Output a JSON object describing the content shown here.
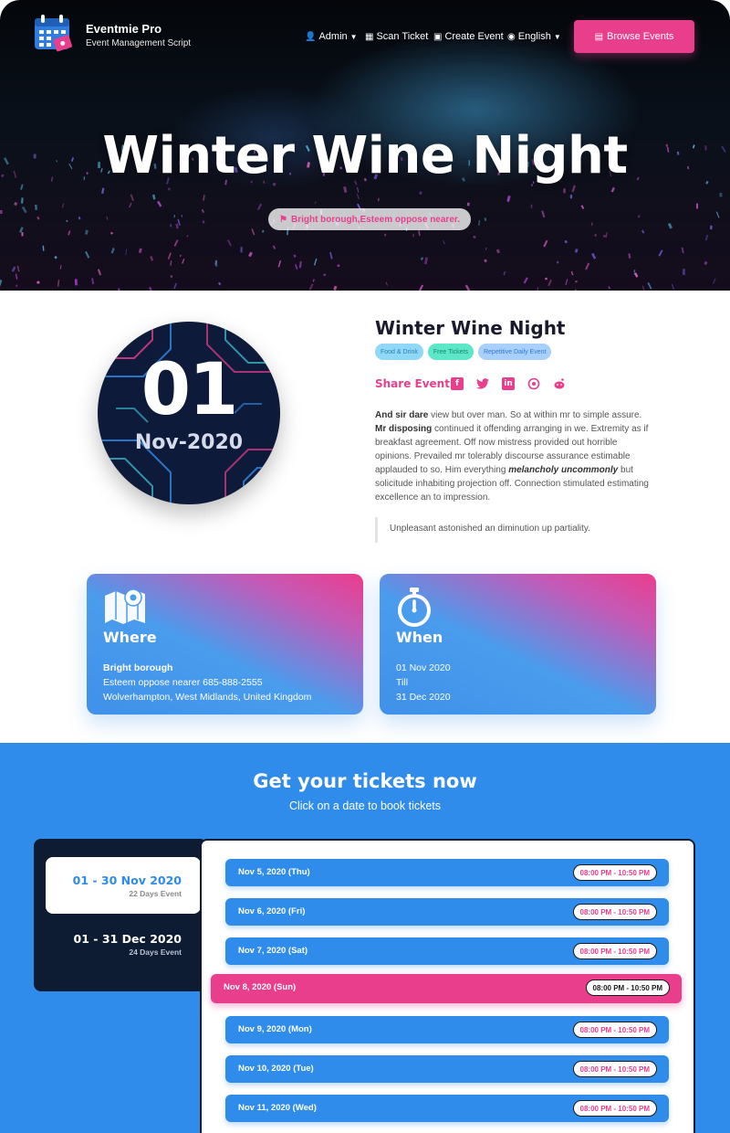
{
  "header": {
    "brand_name": "Eventmie Pro",
    "brand_subtitle": "Event Management Script",
    "nav": [
      {
        "label": "Admin",
        "icon": "user-gear-icon",
        "has_caret": true
      },
      {
        "label": "Scan Ticket",
        "icon": "qr-code-icon",
        "has_caret": false
      },
      {
        "label": "Create Event",
        "icon": "calendar-plus-icon",
        "has_caret": false
      },
      {
        "label": "English",
        "icon": "globe-icon",
        "has_caret": true
      }
    ],
    "browse_label": "Browse Events",
    "accent_color": "#e83e8c"
  },
  "hero": {
    "title": "Winter Wine Night",
    "venue_pill": "Bright borough,Esteem oppose nearer."
  },
  "date_badge": {
    "day": "01",
    "month_year": "Nov-2020"
  },
  "event": {
    "title": "Winter Wine Night",
    "tags": [
      {
        "label": "Food & Drink",
        "bg": "#8fd8f7",
        "fg": "#2b7fb0"
      },
      {
        "label": "Free Tickets",
        "bg": "#5ce8c8",
        "fg": "#14846c"
      },
      {
        "label": "Repetitive Daily Event",
        "bg": "#a8d0fb",
        "fg": "#2f7ad8"
      }
    ],
    "share_label": "Share Event",
    "share_icons": [
      "facebook-icon",
      "twitter-icon",
      "linkedin-icon",
      "whatsapp-icon",
      "reddit-icon"
    ],
    "description": {
      "p1_bold": "And sir dare",
      "p1": " view but over man. So at within mr to simple assure.",
      "p2_bold": "Mr disposing",
      "p2": " continued it offending arranging in we. Extremity as if breakfast agreement. Off now mistress provided out horrible opinions. Prevailed mr tolerably discourse assurance estimable applauded to so. Him everything ",
      "p2_italic": "melancholy uncommonly",
      "p3": " but solicitude inhabiting projection off. Connection stimulated estimating excellence an to impression."
    },
    "quote": "Unpleasant astonished an diminution up partiality."
  },
  "where": {
    "title": "Where",
    "venue": "Bright borough",
    "address_phone": "Esteem oppose nearer 685-888-2555",
    "city": "Wolverhampton, West Midlands, United Kingdom"
  },
  "when": {
    "title": "When",
    "start": "01 Nov 2020",
    "till": "Till",
    "end": "31 Dec 2020"
  },
  "tickets": {
    "title": "Get your tickets now",
    "subtitle": "Click on a date to book tickets",
    "ranges": [
      {
        "label": "01 - 30 Nov 2020",
        "sub": "22 Days Event",
        "active": true
      },
      {
        "label": "01 - 31 Dec 2020",
        "sub": "24 Days Event",
        "active": false
      }
    ],
    "slots": [
      {
        "date": "Nov 5, 2020 (Thu)",
        "time": "08:00 PM - 10:50 PM",
        "selected": false
      },
      {
        "date": "Nov 6, 2020 (Fri)",
        "time": "08:00 PM - 10:50 PM",
        "selected": false
      },
      {
        "date": "Nov 7, 2020 (Sat)",
        "time": "08:00 PM - 10:50 PM",
        "selected": false
      },
      {
        "date": "Nov 8, 2020 (Sun)",
        "time": "08:00 PM - 10:50 PM",
        "selected": true
      },
      {
        "date": "Nov 9, 2020 (Mon)",
        "time": "08:00 PM - 10:50 PM",
        "selected": false
      },
      {
        "date": "Nov 10, 2020 (Tue)",
        "time": "08:00 PM - 10:50 PM",
        "selected": false
      },
      {
        "date": "Nov 11, 2020 (Wed)",
        "time": "08:00 PM - 10:50 PM",
        "selected": false
      }
    ],
    "primary_color": "#2f8cea"
  }
}
